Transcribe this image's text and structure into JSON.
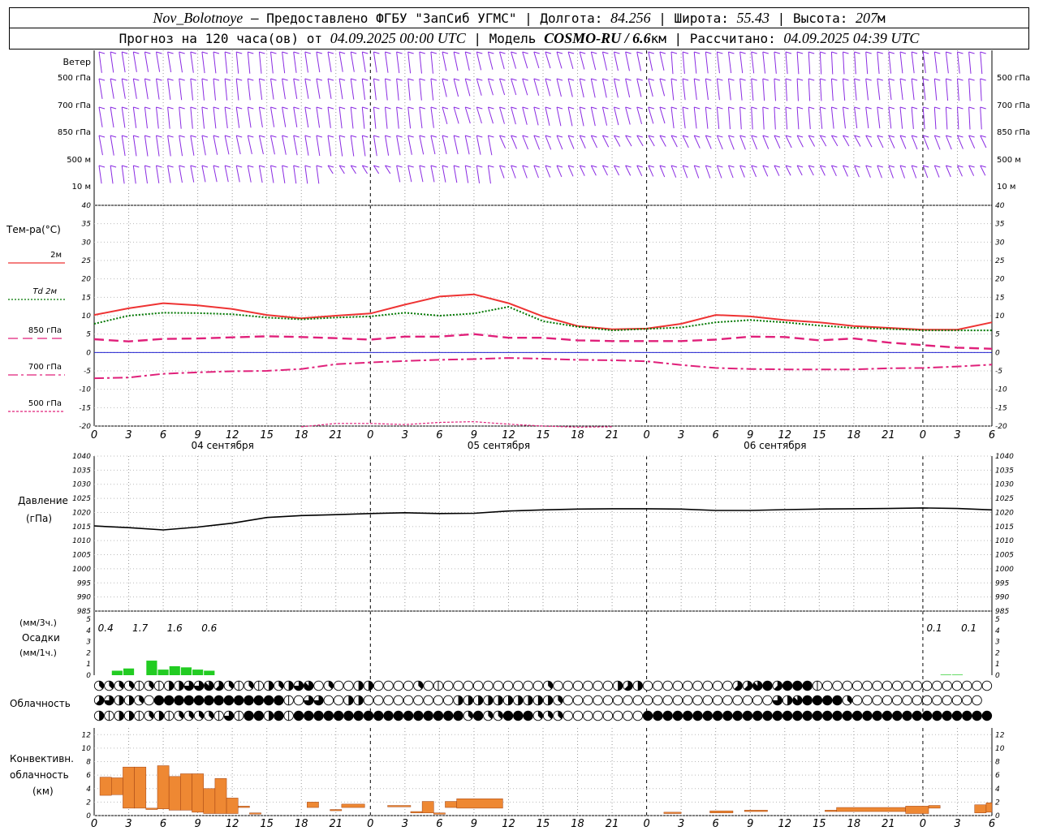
{
  "header": {
    "station": "Nov_Bolotnoye",
    "provider": "– Предоставлено ФГБУ \"ЗапСиб УГМС\"",
    "lon_label": "Долгота:",
    "lon": "84.256",
    "lat_label": "Широта:",
    "lat": "55.43",
    "alt_label": "Высота:",
    "alt": "207",
    "alt_unit": "м",
    "fc_label": "Прогноз на 120 часа(ов) от",
    "fc_time": "04.09.2025 00:00 UTC",
    "model_label": "Модель",
    "model": "COSMO-RU / 6.6",
    "model_unit": "км",
    "calc_label": "Рассчитано:",
    "calc_time": "04.09.2025 04:39 UTC"
  },
  "colors": {
    "wind": "#8a2be2",
    "t2m": "#ee3333",
    "td2m": "#007700",
    "t850": "#e0207a",
    "t700": "#e0207a",
    "t500": "#e0207a",
    "zero_line": "#0000cc",
    "pressure": "#000000",
    "precip": "#22cc22",
    "convective": "#ee8833"
  },
  "time_axis": {
    "ticks": [
      "0",
      "3",
      "6",
      "9",
      "12",
      "15",
      "18",
      "21",
      "0",
      "3",
      "6",
      "9",
      "12",
      "15",
      "18",
      "21",
      "0",
      "3",
      "6",
      "9",
      "12",
      "15",
      "18",
      "21",
      "0",
      "3",
      "6"
    ],
    "dates": [
      "04 сентября",
      "05 сентября",
      "06 сентября"
    ]
  },
  "wind_panel": {
    "title": "Ветер",
    "levels": [
      "500 гПа",
      "700 гПа",
      "850 гПа",
      "500 м",
      "10 м"
    ]
  },
  "chart_data": [
    {
      "type": "line",
      "title": "Тем-ра(°C)",
      "ylim": [
        -20,
        40
      ],
      "yticks": [
        "40",
        "35",
        "30",
        "25",
        "20",
        "15",
        "10",
        "5",
        "0",
        "-5",
        "-10",
        "-15",
        "-20"
      ],
      "x_hours": [
        0,
        3,
        6,
        9,
        12,
        15,
        18,
        21,
        24,
        27,
        30,
        33,
        36,
        39,
        42,
        45,
        48,
        51,
        54,
        57,
        60,
        63,
        66,
        69,
        72,
        75,
        78
      ],
      "series": [
        {
          "name": "2м",
          "values": [
            10.2,
            12,
            13.4,
            12.8,
            11.8,
            10.2,
            9.3,
            10,
            10.6,
            13,
            15.2,
            15.8,
            13.4,
            9.8,
            7.2,
            6.3,
            6.5,
            7.8,
            10.2,
            9.8,
            8.8,
            8.2,
            7.2,
            6.7,
            6.2,
            6.2,
            8.2
          ]
        },
        {
          "name": "Td 2м",
          "values": [
            7.8,
            10,
            10.8,
            10.7,
            10.4,
            9.5,
            9,
            9.5,
            9.8,
            10.8,
            10,
            10.6,
            12.4,
            8.5,
            7,
            6,
            6.4,
            6.8,
            8.2,
            8.8,
            8.2,
            7.3,
            6.7,
            6.4,
            6,
            6,
            6
          ]
        },
        {
          "name": "850 гПа",
          "values": [
            3.6,
            3,
            3.7,
            3.8,
            4.1,
            4.4,
            4.2,
            3.9,
            3.5,
            4.3,
            4.3,
            5,
            4,
            4,
            3.3,
            3.1,
            3.1,
            3.1,
            3.5,
            4.3,
            4.2,
            3.3,
            3.8,
            2.7,
            2,
            1.3,
            1
          ]
        },
        {
          "name": "700 гПа",
          "values": [
            -7,
            -6.8,
            -5.8,
            -5.4,
            -5.1,
            -5,
            -4.5,
            -3.2,
            -2.7,
            -2.3,
            -2,
            -1.8,
            -1.5,
            -1.7,
            -2,
            -2.1,
            -2.4,
            -3.4,
            -4.2,
            -4.5,
            -4.6,
            -4.6,
            -4.6,
            -4.3,
            -4.2,
            -3.8,
            -3.3
          ]
        },
        {
          "name": "500 гПа",
          "values": [
            null,
            null,
            null,
            null,
            null,
            null,
            -20.2,
            -19.3,
            -19.3,
            -19.6,
            -19,
            -18.8,
            -19.5,
            -20,
            -20.3,
            -20.2,
            null,
            null,
            null,
            null,
            null,
            null,
            null,
            null,
            null,
            null,
            null
          ]
        }
      ]
    },
    {
      "type": "line",
      "title": "Давление",
      "ylabel": "(гПа)",
      "ylim": [
        985,
        1040
      ],
      "yticks": [
        "1040",
        "1035",
        "1030",
        "1025",
        "1020",
        "1015",
        "1010",
        "1005",
        "1000",
        "995",
        "990",
        "985"
      ],
      "x_hours": [
        0,
        3,
        6,
        9,
        12,
        15,
        18,
        21,
        24,
        27,
        30,
        33,
        36,
        39,
        42,
        45,
        48,
        51,
        54,
        57,
        60,
        63,
        66,
        69,
        72,
        75,
        78
      ],
      "series": [
        {
          "values": [
            1015.2,
            1014.6,
            1013.8,
            1014.8,
            1016.2,
            1018.2,
            1018.9,
            1019.2,
            1019.6,
            1019.9,
            1019.6,
            1019.7,
            1020.5,
            1020.9,
            1021.2,
            1021.3,
            1021.3,
            1021.2,
            1020.7,
            1020.7,
            1021,
            1021.2,
            1021.3,
            1021.4,
            1021.6,
            1021.4,
            1020.9
          ]
        }
      ]
    },
    {
      "type": "bar",
      "title": "Осадки",
      "ylabel_top": "(мм/3ч.)",
      "ylabel_bottom": "(мм/1ч.)",
      "ylim": [
        0,
        5
      ],
      "yticks": [
        "5",
        "4",
        "3",
        "2",
        "1",
        "0"
      ],
      "labels": [
        {
          "x": 1,
          "text": "0.4"
        },
        {
          "x": 4,
          "text": "1.7"
        },
        {
          "x": 7,
          "text": "1.6"
        },
        {
          "x": 10,
          "text": "0.6"
        },
        {
          "x": 73,
          "text": "0.1"
        },
        {
          "x": 76,
          "text": "0.1"
        }
      ],
      "hourly": {
        "hours": [
          2,
          3,
          5,
          6,
          7,
          8,
          9,
          10,
          74,
          75
        ],
        "values": [
          0.4,
          0.6,
          1.3,
          0.5,
          0.8,
          0.7,
          0.5,
          0.4,
          0.05,
          0.05
        ]
      }
    },
    {
      "type": "table",
      "title": "Облачность",
      "note": "cloud-cover symbols per hour, 3 rows (upper/middle/lower), value = octas",
      "rows": [
        [
          3,
          3,
          3,
          3,
          2,
          3,
          2,
          4,
          4,
          6,
          6,
          7,
          5,
          3,
          2,
          3,
          2,
          4,
          3,
          4,
          6,
          7,
          0,
          3,
          0,
          0,
          4,
          4,
          0,
          0,
          0,
          0,
          3,
          0,
          2,
          0,
          0,
          0,
          0,
          0,
          0,
          0,
          0,
          0,
          0,
          3,
          0,
          0,
          0,
          0,
          0,
          0,
          4,
          5,
          4,
          0,
          0,
          0,
          0,
          0,
          0,
          0,
          0,
          0,
          5,
          5,
          7,
          8,
          5,
          8,
          8,
          8,
          2,
          0,
          0,
          0,
          0,
          0,
          0,
          0,
          0,
          0,
          0,
          0,
          0,
          0,
          0,
          0,
          0,
          0
        ],
        [
          5,
          6,
          4,
          4,
          3,
          0,
          8,
          8,
          8,
          8,
          8,
          8,
          8,
          8,
          8,
          8,
          8,
          8,
          8,
          2,
          0,
          6,
          6,
          0,
          0,
          4,
          4,
          0,
          0,
          0,
          0,
          0,
          0,
          0,
          0,
          0,
          4,
          4,
          4,
          4,
          4,
          4,
          4,
          4,
          4,
          4,
          3,
          0,
          0,
          0,
          0,
          0,
          0,
          0,
          0,
          0,
          0,
          0,
          0,
          0,
          0,
          0,
          0,
          0,
          0,
          0,
          0,
          0,
          6,
          4,
          7,
          8,
          8,
          8,
          8,
          3,
          0,
          0,
          0,
          0,
          0,
          0,
          0,
          0,
          0,
          0,
          0,
          0,
          0
        ],
        [
          4,
          2,
          4,
          4,
          2,
          3,
          4,
          2,
          3,
          3,
          3,
          3,
          2,
          6,
          2,
          8,
          8,
          4,
          8,
          2,
          8,
          8,
          8,
          8,
          8,
          8,
          8,
          8,
          8,
          8,
          8,
          8,
          8,
          8,
          8,
          8,
          8,
          3,
          8,
          3,
          3,
          8,
          8,
          8,
          3,
          3,
          3,
          0,
          0,
          0,
          0,
          0,
          0,
          0,
          0,
          8,
          8,
          8,
          8,
          8,
          8,
          8,
          8,
          8,
          8,
          8,
          8,
          8,
          8,
          8,
          8,
          8,
          8,
          8,
          8,
          8,
          8,
          8,
          8,
          8,
          8,
          8,
          8,
          8,
          8,
          8,
          8,
          8,
          8,
          8
        ]
      ]
    },
    {
      "type": "bar",
      "title": "Конвективн.",
      "ylabel": "облачность",
      "unit": "(км)",
      "ylim": [
        0,
        13
      ],
      "yticks": [
        "12",
        "10",
        "8",
        "6",
        "4",
        "2",
        "0"
      ],
      "segments": [
        {
          "h0": 0.5,
          "h1": 1.5,
          "base": 3,
          "top": 5.7
        },
        {
          "h0": 1.5,
          "h1": 2.5,
          "base": 3.1,
          "top": 5.6
        },
        {
          "h0": 2.5,
          "h1": 3.5,
          "base": 1.1,
          "top": 7.2
        },
        {
          "h0": 3.5,
          "h1": 4.5,
          "base": 1.1,
          "top": 7.2
        },
        {
          "h0": 4.5,
          "h1": 5.5,
          "base": 0.9,
          "top": 1.1
        },
        {
          "h0": 5.5,
          "h1": 6.5,
          "base": 1,
          "top": 7.4
        },
        {
          "h0": 6.5,
          "h1": 7.5,
          "base": 0.8,
          "top": 5.8
        },
        {
          "h0": 7.5,
          "h1": 8.5,
          "base": 0.8,
          "top": 6.2
        },
        {
          "h0": 8.5,
          "h1": 9.5,
          "base": 0.5,
          "top": 6.2
        },
        {
          "h0": 9.5,
          "h1": 10.5,
          "base": 0.3,
          "top": 4
        },
        {
          "h0": 10.5,
          "h1": 11.5,
          "base": 0.3,
          "top": 5.5
        },
        {
          "h0": 11.5,
          "h1": 12.5,
          "base": 0.3,
          "top": 2.6
        },
        {
          "h0": 12.5,
          "h1": 13.5,
          "base": 1.2,
          "top": 1.4
        },
        {
          "h0": 13.5,
          "h1": 14.5,
          "base": 0.3,
          "top": 0.4
        },
        {
          "h0": 18.5,
          "h1": 19.5,
          "base": 1.2,
          "top": 2
        },
        {
          "h0": 20.5,
          "h1": 21.5,
          "base": 0.8,
          "top": 0.9
        },
        {
          "h0": 21.5,
          "h1": 23.5,
          "base": 1.2,
          "top": 1.7
        },
        {
          "h0": 25.5,
          "h1": 27.5,
          "base": 1.3,
          "top": 1.5
        },
        {
          "h0": 27.5,
          "h1": 28.5,
          "base": 0.4,
          "top": 0.6
        },
        {
          "h0": 28.5,
          "h1": 29.5,
          "base": 0.4,
          "top": 2.1
        },
        {
          "h0": 29.5,
          "h1": 30.5,
          "base": 0.2,
          "top": 0.4
        },
        {
          "h0": 30.5,
          "h1": 31.5,
          "base": 1.2,
          "top": 2.1
        },
        {
          "h0": 31.5,
          "h1": 35.5,
          "base": 1.1,
          "top": 2.5
        },
        {
          "h0": 49.5,
          "h1": 51,
          "base": 0.3,
          "top": 0.5
        },
        {
          "h0": 53.5,
          "h1": 55.5,
          "base": 0.4,
          "top": 0.7
        },
        {
          "h0": 56.5,
          "h1": 58.5,
          "base": 0.6,
          "top": 0.8
        },
        {
          "h0": 63.5,
          "h1": 64.5,
          "base": 0.6,
          "top": 0.8
        },
        {
          "h0": 64.5,
          "h1": 70.5,
          "base": 0.6,
          "top": 1.2
        },
        {
          "h0": 70.5,
          "h1": 72.5,
          "base": 0.3,
          "top": 1.4
        },
        {
          "h0": 72.5,
          "h1": 73.5,
          "base": 1.1,
          "top": 1.5
        },
        {
          "h0": 76.5,
          "h1": 77.5,
          "base": 0.4,
          "top": 1.6
        },
        {
          "h0": 77.5,
          "h1": 78,
          "base": 0.5,
          "top": 1.9
        }
      ]
    }
  ]
}
